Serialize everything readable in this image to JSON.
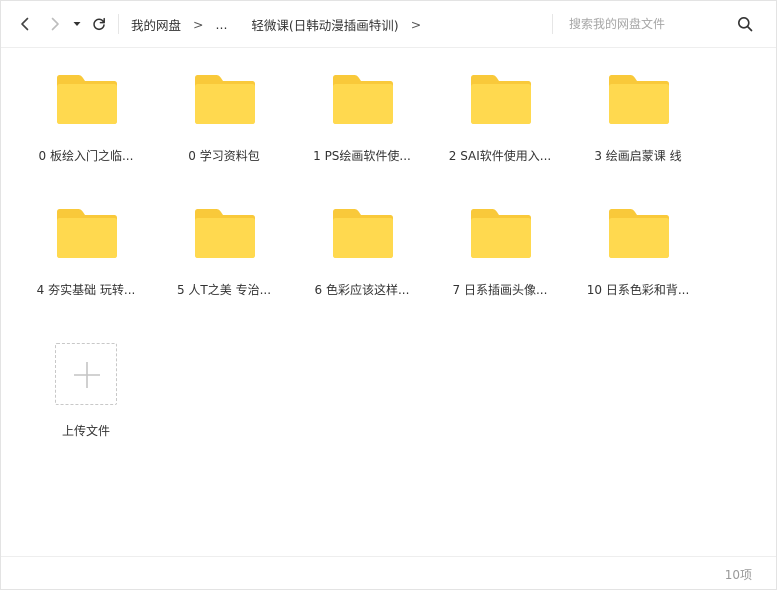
{
  "toolbar": {
    "back_icon": "chevron-left-icon",
    "forward_icon": "chevron-right-icon",
    "dropdown_icon": "caret-down-icon",
    "refresh_icon": "refresh-icon"
  },
  "breadcrumb": {
    "root": "我的网盘",
    "arrow": ">",
    "ellipsis": "...",
    "current": "轻微课(日韩动漫插画特训)",
    "trailing_arrow": ">"
  },
  "search": {
    "placeholder": "搜索我的网盘文件",
    "icon": "search-icon"
  },
  "folders": [
    {
      "label": "0 板绘入门之临..."
    },
    {
      "label": "0 学习资料包"
    },
    {
      "label": "1 PS绘画软件使..."
    },
    {
      "label": "2 SAI软件使用入..."
    },
    {
      "label": "3 绘画启蒙课 线"
    },
    {
      "label": "4 夯实基础 玩转..."
    },
    {
      "label": "5 人T之美 专治..."
    },
    {
      "label": "6 色彩应该这样..."
    },
    {
      "label": "7 日系插画头像..."
    },
    {
      "label": "10 日系色彩和背..."
    }
  ],
  "upload": {
    "label": "上传文件",
    "icon": "plus-icon"
  },
  "footer": {
    "count": "10项"
  },
  "colors": {
    "folder_back": "#F9C93A",
    "folder_front": "#FFD94F",
    "text": "#333333",
    "muted": "#999999"
  }
}
